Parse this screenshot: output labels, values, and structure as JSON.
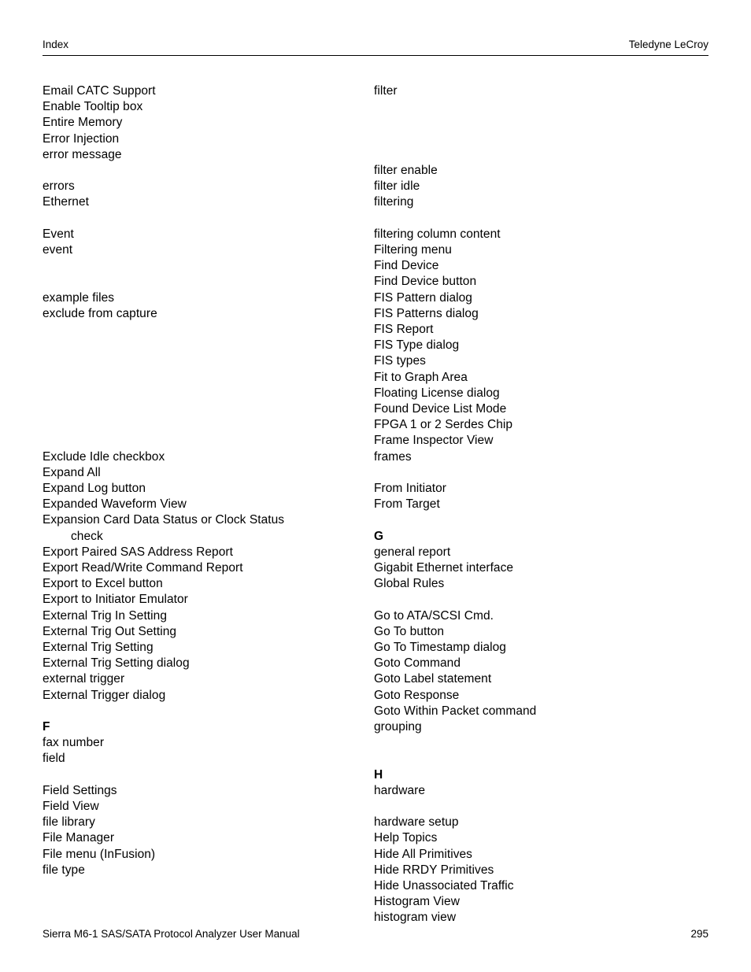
{
  "header": {
    "left": "Index",
    "right": "Teledyne LeCroy"
  },
  "footer": {
    "left": "Sierra M6-1 SAS/SATA Protocol Analyzer User Manual",
    "page_number": "295"
  },
  "columns": {
    "left": {
      "blocks": [
        {
          "type": "entries",
          "items": [
            "Email CATC Support",
            "Enable Tooltip box",
            "Entire Memory",
            "Error Injection",
            "error message"
          ]
        },
        {
          "type": "gap",
          "lines": 1
        },
        {
          "type": "entries",
          "items": [
            "errors",
            "Ethernet"
          ]
        },
        {
          "type": "gap",
          "lines": 1
        },
        {
          "type": "entries",
          "items": [
            "Event",
            "event"
          ]
        },
        {
          "type": "gap",
          "lines": 2
        },
        {
          "type": "entries",
          "items": [
            "example files",
            "exclude from capture"
          ]
        },
        {
          "type": "gap",
          "lines": 8
        },
        {
          "type": "entries",
          "items": [
            "Exclude Idle checkbox",
            "Expand All",
            "Expand Log button",
            "Expanded Waveform View",
            "Expansion Card Data Status or Clock Status"
          ]
        },
        {
          "type": "continuation",
          "items": [
            "check"
          ]
        },
        {
          "type": "entries",
          "items": [
            "Export Paired SAS Address Report",
            "Export Read/Write Command Report",
            "Export to Excel button",
            "Export to Initiator Emulator",
            "External Trig In Setting",
            "External Trig Out Setting",
            "External Trig Setting",
            "External Trig Setting dialog",
            "external trigger",
            "External Trigger dialog"
          ]
        },
        {
          "type": "gap",
          "lines": 1
        },
        {
          "type": "heading",
          "label": "F"
        },
        {
          "type": "entries",
          "items": [
            "fax number",
            "field"
          ]
        },
        {
          "type": "gap",
          "lines": 1
        },
        {
          "type": "entries",
          "items": [
            "Field Settings",
            "Field View",
            "file library",
            "File Manager",
            "File menu (InFusion)",
            "file type"
          ]
        }
      ]
    },
    "right": {
      "blocks": [
        {
          "type": "entries",
          "items": [
            "filter"
          ]
        },
        {
          "type": "gap",
          "lines": 4
        },
        {
          "type": "entries",
          "items": [
            "filter enable",
            "filter idle",
            "filtering"
          ]
        },
        {
          "type": "gap",
          "lines": 1
        },
        {
          "type": "entries",
          "items": [
            "filtering column content",
            "Filtering menu",
            "Find Device",
            "Find Device button",
            "FIS Pattern dialog",
            "FIS Patterns dialog",
            "FIS Report",
            "FIS Type dialog",
            "FIS types",
            "Fit to Graph Area",
            "Floating License dialog",
            "Found Device List Mode",
            "FPGA 1 or 2 Serdes Chip",
            "Frame Inspector View",
            "frames"
          ]
        },
        {
          "type": "gap",
          "lines": 1
        },
        {
          "type": "entries",
          "items": [
            "From Initiator",
            "From Target"
          ]
        },
        {
          "type": "gap",
          "lines": 1
        },
        {
          "type": "heading",
          "label": "G"
        },
        {
          "type": "entries",
          "items": [
            "general report",
            "Gigabit Ethernet interface",
            "Global Rules"
          ]
        },
        {
          "type": "gap",
          "lines": 1
        },
        {
          "type": "entries",
          "items": [
            "Go to ATA/SCSI Cmd.",
            "Go To button",
            "Go To Timestamp dialog",
            "Goto Command",
            "Goto Label statement",
            "Goto Response",
            "Goto Within Packet command",
            "grouping"
          ]
        },
        {
          "type": "gap",
          "lines": 2
        },
        {
          "type": "heading",
          "label": "H"
        },
        {
          "type": "entries",
          "items": [
            "hardware"
          ]
        },
        {
          "type": "gap",
          "lines": 1
        },
        {
          "type": "entries",
          "items": [
            "hardware setup",
            "Help Topics",
            "Hide All Primitives",
            "Hide RRDY Primitives",
            "Hide Unassociated Traffic",
            "Histogram View",
            "histogram view"
          ]
        }
      ]
    }
  }
}
